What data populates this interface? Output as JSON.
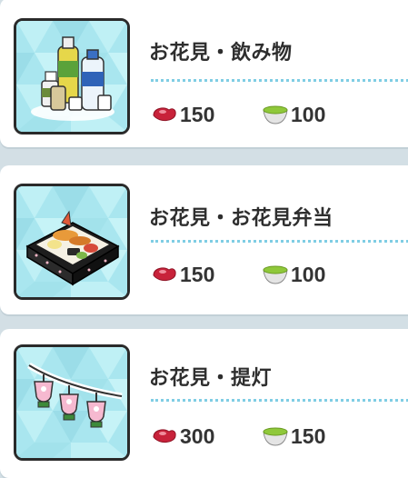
{
  "items": [
    {
      "name": "お花見・飲み物",
      "costs": [
        {
          "icon": "red-bean-icon",
          "value": "150"
        },
        {
          "icon": "green-tea-icon",
          "value": "100"
        }
      ],
      "image": "drinks-bottles-icon"
    },
    {
      "name": "お花見・お花見弁当",
      "costs": [
        {
          "icon": "red-bean-icon",
          "value": "150"
        },
        {
          "icon": "green-tea-icon",
          "value": "100"
        }
      ],
      "image": "bento-box-icon"
    },
    {
      "name": "お花見・提灯",
      "costs": [
        {
          "icon": "red-bean-icon",
          "value": "300"
        },
        {
          "icon": "green-tea-icon",
          "value": "150"
        }
      ],
      "image": "lanterns-icon"
    }
  ],
  "colors": {
    "card_bg": "#ffffff",
    "page_bg": "#d3dfe5",
    "thumb_bg": "#a9e6ef",
    "dotted_divider": "#7fcde4",
    "bean_red": "#c8223a",
    "tea_green": "#8fc83a"
  }
}
